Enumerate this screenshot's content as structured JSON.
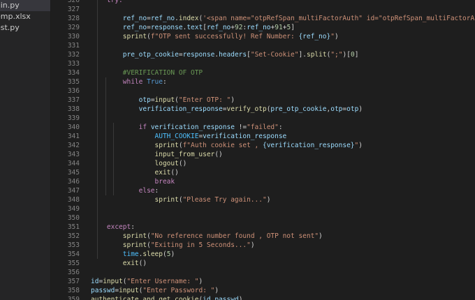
{
  "explorer": {
    "items": [
      {
        "label": "ain.py",
        "active": true
      },
      {
        "label": "emp.xlsx",
        "active": false
      },
      {
        "label": "est.py",
        "active": false
      }
    ]
  },
  "editor": {
    "lines": [
      {
        "number": "326",
        "indent": 2,
        "tokens": [
          {
            "t": "try:",
            "c": "tok-keyword"
          }
        ]
      },
      {
        "number": "327",
        "indent": 0,
        "tokens": []
      },
      {
        "number": "328",
        "indent": 4,
        "tokens": [
          {
            "t": "ref_no",
            "c": "tok-variable"
          },
          {
            "t": "=",
            "c": "tok-plain"
          },
          {
            "t": "ref_no",
            "c": "tok-variable"
          },
          {
            "t": ".",
            "c": "tok-plain"
          },
          {
            "t": "index",
            "c": "tok-function"
          },
          {
            "t": "(",
            "c": "tok-plain"
          },
          {
            "t": "'<span name=\"otpRefSpan_multiFactorAuth\" id=\"otpRefSpan_multiFactorAuth\" class=",
            "c": "tok-string"
          }
        ]
      },
      {
        "number": "329",
        "indent": 4,
        "tokens": [
          {
            "t": "ref_no",
            "c": "tok-variable"
          },
          {
            "t": "=",
            "c": "tok-plain"
          },
          {
            "t": "response",
            "c": "tok-variable"
          },
          {
            "t": ".",
            "c": "tok-plain"
          },
          {
            "t": "text",
            "c": "tok-variable"
          },
          {
            "t": "[",
            "c": "tok-plain"
          },
          {
            "t": "ref_no",
            "c": "tok-variable"
          },
          {
            "t": "+",
            "c": "tok-plain"
          },
          {
            "t": "92",
            "c": "tok-number"
          },
          {
            "t": ":",
            "c": "tok-plain"
          },
          {
            "t": "ref_no",
            "c": "tok-variable"
          },
          {
            "t": "+",
            "c": "tok-plain"
          },
          {
            "t": "91",
            "c": "tok-number"
          },
          {
            "t": "+",
            "c": "tok-plain"
          },
          {
            "t": "5",
            "c": "tok-number"
          },
          {
            "t": "]",
            "c": "tok-plain"
          }
        ]
      },
      {
        "number": "330",
        "indent": 4,
        "tokens": [
          {
            "t": "sprint",
            "c": "tok-function"
          },
          {
            "t": "(",
            "c": "tok-plain"
          },
          {
            "t": "f\"OTP sent successfully! Ref Number: ",
            "c": "tok-string"
          },
          {
            "t": "{ref_no}",
            "c": "tok-variable"
          },
          {
            "t": "\"",
            "c": "tok-string"
          },
          {
            "t": ")",
            "c": "tok-plain"
          }
        ]
      },
      {
        "number": "331",
        "indent": 0,
        "tokens": []
      },
      {
        "number": "332",
        "indent": 4,
        "tokens": [
          {
            "t": "pre_otp_cookie",
            "c": "tok-variable"
          },
          {
            "t": "=",
            "c": "tok-plain"
          },
          {
            "t": "response",
            "c": "tok-variable"
          },
          {
            "t": ".",
            "c": "tok-plain"
          },
          {
            "t": "headers",
            "c": "tok-variable"
          },
          {
            "t": "[",
            "c": "tok-plain"
          },
          {
            "t": "\"Set-Cookie\"",
            "c": "tok-string"
          },
          {
            "t": "]",
            "c": "tok-plain"
          },
          {
            "t": ".",
            "c": "tok-plain"
          },
          {
            "t": "split",
            "c": "tok-function"
          },
          {
            "t": "(",
            "c": "tok-plain"
          },
          {
            "t": "\";\"",
            "c": "tok-string"
          },
          {
            "t": ")",
            "c": "tok-plain"
          },
          {
            "t": "[",
            "c": "tok-plain"
          },
          {
            "t": "0",
            "c": "tok-number"
          },
          {
            "t": "]",
            "c": "tok-plain"
          }
        ]
      },
      {
        "number": "333",
        "indent": 0,
        "tokens": []
      },
      {
        "number": "334",
        "indent": 4,
        "tokens": [
          {
            "t": "#VERIFICATION OF OTP",
            "c": "tok-comment"
          }
        ]
      },
      {
        "number": "335",
        "indent": 4,
        "tokens": [
          {
            "t": "while",
            "c": "tok-keyword"
          },
          {
            "t": " ",
            "c": "tok-plain"
          },
          {
            "t": "True",
            "c": "tok-keyword-blue"
          },
          {
            "t": ":",
            "c": "tok-plain"
          }
        ]
      },
      {
        "number": "336",
        "indent": 0,
        "tokens": []
      },
      {
        "number": "337",
        "indent": 6,
        "tokens": [
          {
            "t": "otp",
            "c": "tok-variable"
          },
          {
            "t": "=",
            "c": "tok-plain"
          },
          {
            "t": "input",
            "c": "tok-function"
          },
          {
            "t": "(",
            "c": "tok-plain"
          },
          {
            "t": "\"Enter OTP: \"",
            "c": "tok-string"
          },
          {
            "t": ")",
            "c": "tok-plain"
          }
        ]
      },
      {
        "number": "338",
        "indent": 6,
        "tokens": [
          {
            "t": "verification_response",
            "c": "tok-variable"
          },
          {
            "t": "=",
            "c": "tok-plain"
          },
          {
            "t": "verify_otp",
            "c": "tok-function"
          },
          {
            "t": "(",
            "c": "tok-plain"
          },
          {
            "t": "pre_otp_cookie",
            "c": "tok-variable"
          },
          {
            "t": ",",
            "c": "tok-plain"
          },
          {
            "t": "otp",
            "c": "tok-variable"
          },
          {
            "t": "=",
            "c": "tok-plain"
          },
          {
            "t": "otp",
            "c": "tok-variable"
          },
          {
            "t": ")",
            "c": "tok-plain"
          }
        ]
      },
      {
        "number": "339",
        "indent": 0,
        "tokens": []
      },
      {
        "number": "340",
        "indent": 6,
        "tokens": [
          {
            "t": "if",
            "c": "tok-keyword"
          },
          {
            "t": " ",
            "c": "tok-plain"
          },
          {
            "t": "verification_response",
            "c": "tok-variable"
          },
          {
            "t": " !=",
            "c": "tok-plain"
          },
          {
            "t": "\"failed\"",
            "c": "tok-string"
          },
          {
            "t": ":",
            "c": "tok-plain"
          }
        ]
      },
      {
        "number": "341",
        "indent": 8,
        "tokens": [
          {
            "t": "AUTH_COOKIE",
            "c": "tok-constant"
          },
          {
            "t": "=",
            "c": "tok-plain"
          },
          {
            "t": "verification_response",
            "c": "tok-variable"
          }
        ]
      },
      {
        "number": "342",
        "indent": 8,
        "tokens": [
          {
            "t": "sprint",
            "c": "tok-function"
          },
          {
            "t": "(",
            "c": "tok-plain"
          },
          {
            "t": "f\"Auth cookie set , ",
            "c": "tok-string"
          },
          {
            "t": "{verification_response}",
            "c": "tok-variable"
          },
          {
            "t": "\"",
            "c": "tok-string"
          },
          {
            "t": ")",
            "c": "tok-plain"
          }
        ]
      },
      {
        "number": "343",
        "indent": 8,
        "tokens": [
          {
            "t": "input_from_user",
            "c": "tok-function"
          },
          {
            "t": "()",
            "c": "tok-plain"
          }
        ]
      },
      {
        "number": "344",
        "indent": 8,
        "tokens": [
          {
            "t": "logout",
            "c": "tok-function"
          },
          {
            "t": "()",
            "c": "tok-plain"
          }
        ]
      },
      {
        "number": "345",
        "indent": 8,
        "tokens": [
          {
            "t": "exit",
            "c": "tok-function"
          },
          {
            "t": "()",
            "c": "tok-plain"
          }
        ]
      },
      {
        "number": "346",
        "indent": 8,
        "tokens": [
          {
            "t": "break",
            "c": "tok-break"
          }
        ]
      },
      {
        "number": "347",
        "indent": 6,
        "tokens": [
          {
            "t": "else",
            "c": "tok-keyword"
          },
          {
            "t": ":",
            "c": "tok-plain"
          }
        ]
      },
      {
        "number": "348",
        "indent": 8,
        "tokens": [
          {
            "t": "sprint",
            "c": "tok-function"
          },
          {
            "t": "(",
            "c": "tok-plain"
          },
          {
            "t": "\"Please Try again...\"",
            "c": "tok-string"
          },
          {
            "t": ")",
            "c": "tok-plain"
          }
        ]
      },
      {
        "number": "349",
        "indent": 0,
        "tokens": []
      },
      {
        "number": "350",
        "indent": 0,
        "tokens": []
      },
      {
        "number": "351",
        "indent": 2,
        "tokens": [
          {
            "t": "except",
            "c": "tok-keyword"
          },
          {
            "t": ":",
            "c": "tok-plain"
          }
        ]
      },
      {
        "number": "352",
        "indent": 4,
        "tokens": [
          {
            "t": "sprint",
            "c": "tok-function"
          },
          {
            "t": "(",
            "c": "tok-plain"
          },
          {
            "t": "\"No reference number found , OTP not sent\"",
            "c": "tok-string"
          },
          {
            "t": ")",
            "c": "tok-plain"
          }
        ]
      },
      {
        "number": "353",
        "indent": 4,
        "tokens": [
          {
            "t": "sprint",
            "c": "tok-function"
          },
          {
            "t": "(",
            "c": "tok-plain"
          },
          {
            "t": "\"Exiting in 5 Seconds...\"",
            "c": "tok-string"
          },
          {
            "t": ")",
            "c": "tok-plain"
          }
        ]
      },
      {
        "number": "354",
        "indent": 4,
        "tokens": [
          {
            "t": "time",
            "c": "tok-constant"
          },
          {
            "t": ".",
            "c": "tok-plain"
          },
          {
            "t": "sleep",
            "c": "tok-function"
          },
          {
            "t": "(",
            "c": "tok-plain"
          },
          {
            "t": "5",
            "c": "tok-number"
          },
          {
            "t": ")",
            "c": "tok-plain"
          }
        ]
      },
      {
        "number": "355",
        "indent": 4,
        "tokens": [
          {
            "t": "exit",
            "c": "tok-function"
          },
          {
            "t": "()",
            "c": "tok-plain"
          }
        ]
      },
      {
        "number": "356",
        "indent": 0,
        "tokens": []
      },
      {
        "number": "357",
        "indent": 0,
        "tokens": [
          {
            "t": "id",
            "c": "tok-variable"
          },
          {
            "t": "=",
            "c": "tok-plain"
          },
          {
            "t": "input",
            "c": "tok-function"
          },
          {
            "t": "(",
            "c": "tok-plain"
          },
          {
            "t": "\"Enter Username: \"",
            "c": "tok-string"
          },
          {
            "t": ")",
            "c": "tok-plain"
          }
        ]
      },
      {
        "number": "358",
        "indent": 0,
        "tokens": [
          {
            "t": "passwd",
            "c": "tok-variable"
          },
          {
            "t": "=",
            "c": "tok-plain"
          },
          {
            "t": "input",
            "c": "tok-function"
          },
          {
            "t": "(",
            "c": "tok-plain"
          },
          {
            "t": "\"Enter Password: \"",
            "c": "tok-string"
          },
          {
            "t": ")",
            "c": "tok-plain"
          }
        ]
      },
      {
        "number": "359",
        "indent": 0,
        "tokens": [
          {
            "t": "authenticate_and_get_cookie",
            "c": "tok-function"
          },
          {
            "t": "(",
            "c": "tok-plain"
          },
          {
            "t": "id",
            "c": "tok-variable"
          },
          {
            "t": ",",
            "c": "tok-plain"
          },
          {
            "t": "passwd",
            "c": "tok-variable"
          },
          {
            "t": ")",
            "c": "tok-plain"
          }
        ]
      }
    ]
  }
}
